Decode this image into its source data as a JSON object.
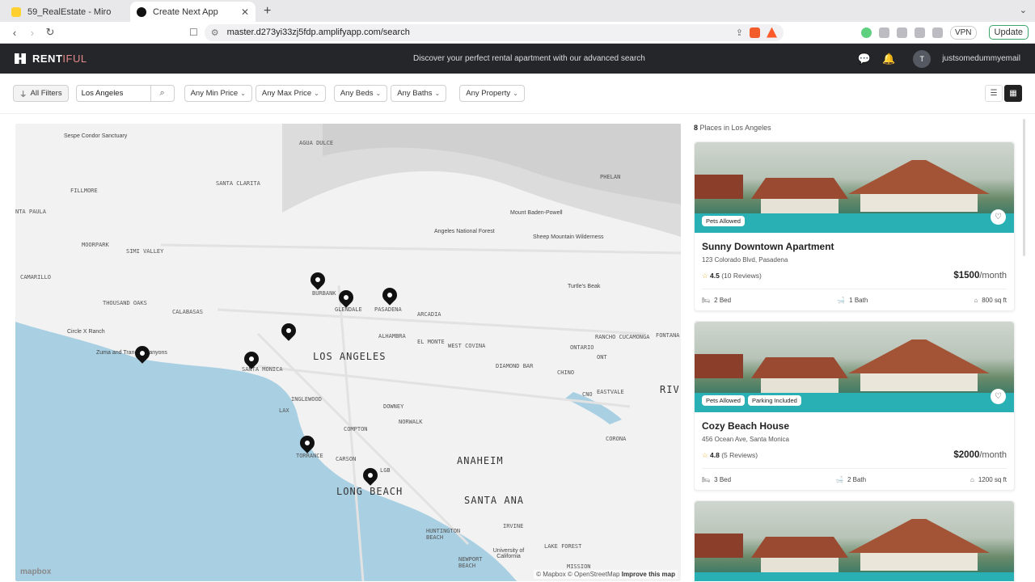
{
  "browser": {
    "tabs": [
      {
        "title": "59_RealEstate - Miro"
      },
      {
        "title": "Create Next App"
      }
    ],
    "new_tab": "+",
    "url": "master.d273yi33zj5fdp.amplifyapp.com/search",
    "vpn": "VPN",
    "update": "Update"
  },
  "header": {
    "brand_part1": "RENT",
    "brand_part2": "IFUL",
    "tagline": "Discover your perfect rental apartment with our advanced search",
    "avatar_initial": "T",
    "user_email": "justsomedummyemail"
  },
  "filters": {
    "all_filters": "All Filters",
    "location_value": "Los Angeles",
    "min_price": "Any Min Price",
    "max_price": "Any Max Price",
    "beds": "Any Beds",
    "baths": "Any Baths",
    "property": "Any Property"
  },
  "map": {
    "labels": [
      {
        "text": "Sespe Condor Sanctuary",
        "kind": "poi"
      },
      {
        "text": "AGUA DULCE",
        "kind": "town"
      },
      {
        "text": "PHELAN",
        "kind": "town"
      },
      {
        "text": "FILLMORE",
        "kind": "town"
      },
      {
        "text": "SANTA CLARITA",
        "kind": "town"
      },
      {
        "text": "NTA PAULA",
        "kind": "town"
      },
      {
        "text": "Mount Baden-Powell",
        "kind": "poi"
      },
      {
        "text": "Angeles National Forest",
        "kind": "poi"
      },
      {
        "text": "Sheep Mountain Wilderness",
        "kind": "poi"
      },
      {
        "text": "MOORPARK",
        "kind": "town"
      },
      {
        "text": "SIMI VALLEY",
        "kind": "town"
      },
      {
        "text": "CAMARILLO",
        "kind": "town"
      },
      {
        "text": "Turtle's Beak",
        "kind": "poi"
      },
      {
        "text": "BURBANK",
        "kind": "town"
      },
      {
        "text": "GLENDALE",
        "kind": "town"
      },
      {
        "text": "PASADENA",
        "kind": "town"
      },
      {
        "text": "THOUSAND OAKS",
        "kind": "town"
      },
      {
        "text": "CALABASAS",
        "kind": "town"
      },
      {
        "text": "ARCADIA",
        "kind": "town"
      },
      {
        "text": "Circle X Ranch",
        "kind": "poi"
      },
      {
        "text": "ALHAMBRA",
        "kind": "town"
      },
      {
        "text": "EL MONTE",
        "kind": "town"
      },
      {
        "text": "WEST COVINA",
        "kind": "town"
      },
      {
        "text": "RANCHO CUCAMONGA",
        "kind": "town"
      },
      {
        "text": "FONTANA",
        "kind": "town"
      },
      {
        "text": "ONTARIO",
        "kind": "town"
      },
      {
        "text": "Zuma and Trancas Canyons",
        "kind": "poi"
      },
      {
        "text": "LOS ANGELES",
        "kind": "city"
      },
      {
        "text": "DIAMOND BAR",
        "kind": "town"
      },
      {
        "text": "ONT",
        "kind": "town"
      },
      {
        "text": "SANTA MONICA",
        "kind": "town"
      },
      {
        "text": "CHINO",
        "kind": "town"
      },
      {
        "text": "RIV",
        "kind": "city"
      },
      {
        "text": "INGLEWOOD",
        "kind": "town"
      },
      {
        "text": "CNO",
        "kind": "town"
      },
      {
        "text": "EASTVALE",
        "kind": "town"
      },
      {
        "text": "LAX",
        "kind": "town"
      },
      {
        "text": "DOWNEY",
        "kind": "town"
      },
      {
        "text": "NORWALK",
        "kind": "town"
      },
      {
        "text": "COMPTON",
        "kind": "town"
      },
      {
        "text": "CORONA",
        "kind": "town"
      },
      {
        "text": "TORRANCE",
        "kind": "town"
      },
      {
        "text": "CARSON",
        "kind": "town"
      },
      {
        "text": "ANAHEIM",
        "kind": "city"
      },
      {
        "text": "LGB",
        "kind": "town"
      },
      {
        "text": "LONG BEACH",
        "kind": "city"
      },
      {
        "text": "SANTA ANA",
        "kind": "city"
      },
      {
        "text": "IRVINE",
        "kind": "town"
      },
      {
        "text": "HUNTINGTON BEACH",
        "kind": "town"
      },
      {
        "text": "LAKE FOREST",
        "kind": "town"
      },
      {
        "text": "University of California",
        "kind": "poi"
      },
      {
        "text": "NEWPORT BEACH",
        "kind": "town"
      },
      {
        "text": "MISSION",
        "kind": "town"
      }
    ],
    "pin_count": 8,
    "logo": "mapbox",
    "attribution": "© Mapbox © OpenStreetMap",
    "improve": "Improve this map"
  },
  "listing": {
    "count": "8",
    "count_suffix": "Places in Los Angeles",
    "cards": [
      {
        "title": "Sunny Downtown Apartment",
        "address": "123 Colorado Blvd, Pasadena",
        "rating": "4.5",
        "reviews": "(10 Reviews)",
        "price": "$1500",
        "per": "/month",
        "beds": "2 Bed",
        "baths": "1 Bath",
        "area": "800 sq ft",
        "badges": [
          "Pets Allowed"
        ]
      },
      {
        "title": "Cozy Beach House",
        "address": "456 Ocean Ave, Santa Monica",
        "rating": "4.8",
        "reviews": "(5 Reviews)",
        "price": "$2000",
        "per": "/month",
        "beds": "3 Bed",
        "baths": "2 Bath",
        "area": "1200 sq ft",
        "badges": [
          "Pets Allowed",
          "Parking Included"
        ]
      }
    ]
  }
}
